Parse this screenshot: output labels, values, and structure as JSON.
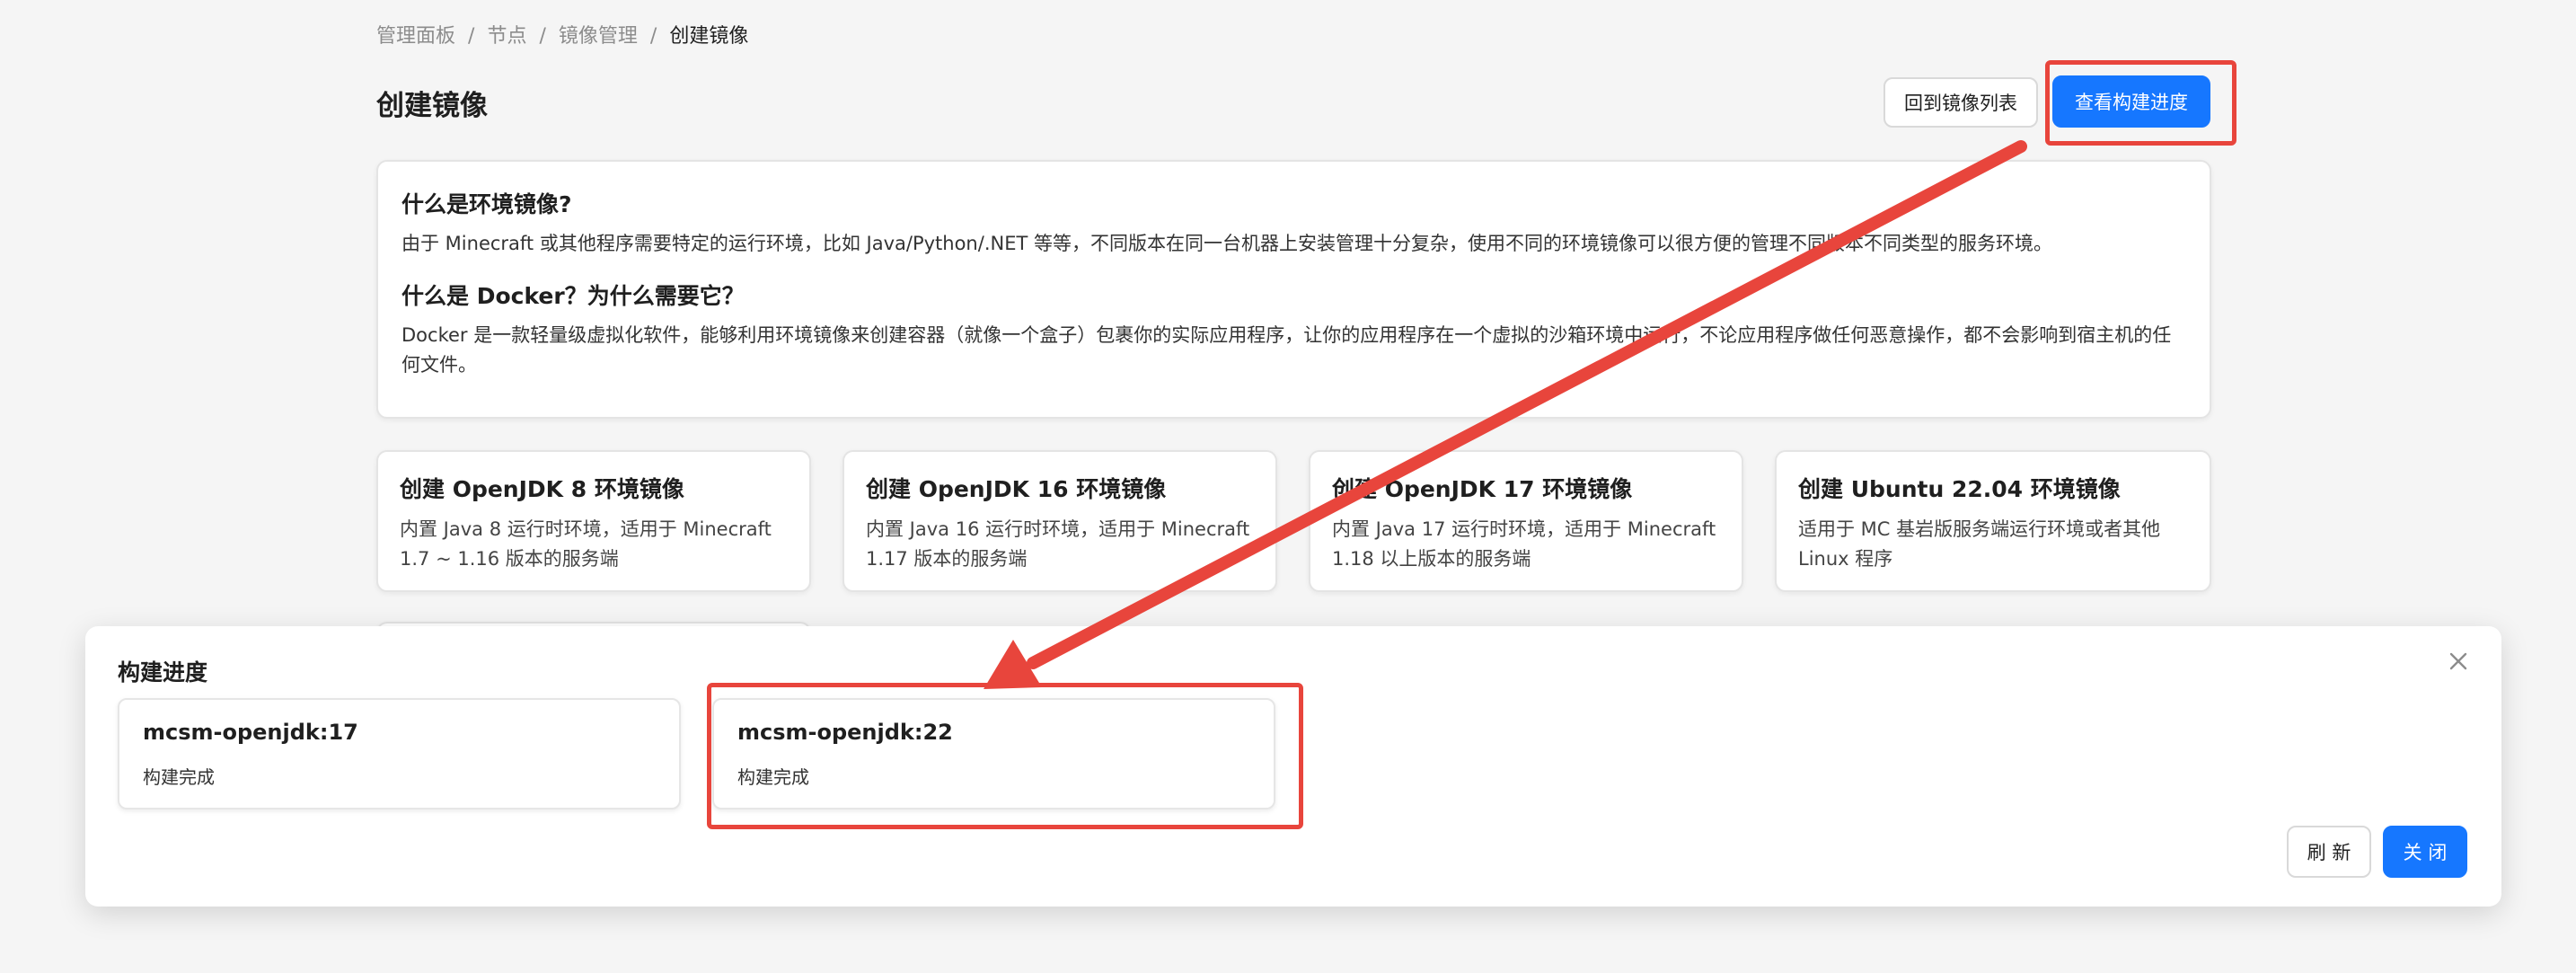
{
  "breadcrumb": {
    "items": [
      "管理面板",
      "节点",
      "镜像管理"
    ],
    "current": "创建镜像",
    "separator": "/"
  },
  "page": {
    "title": "创建镜像",
    "back_button": "回到镜像列表",
    "progress_button": "查看构建进度"
  },
  "info": {
    "q1": "什么是环境镜像?",
    "a1": "由于 Minecraft 或其他程序需要特定的运行环境，比如 Java/Python/.NET 等等，不同版本在同一台机器上安装管理十分复杂，使用不同的环境镜像可以很方便的管理不同版本不同类型的服务环境。",
    "q2": "什么是 Docker？为什么需要它？",
    "a2": "Docker 是一款轻量级虚拟化软件，能够利用环境镜像来创建容器（就像一个盒子）包裹你的实际应用程序，让你的应用程序在一个虚拟的沙箱环境中运行，不论应用程序做任何恶意操作，都不会影响到宿主机的任何文件。"
  },
  "templates": [
    {
      "title": "创建 OpenJDK 8 环境镜像",
      "desc": "内置 Java 8 运行时环境，适用于 Minecraft 1.7 ~ 1.16 版本的服务端"
    },
    {
      "title": "创建 OpenJDK 16 环境镜像",
      "desc": "内置 Java 16 运行时环境，适用于 Minecraft 1.17 版本的服务端"
    },
    {
      "title": "创建 OpenJDK 17 环境镜像",
      "desc": "内置 Java 17 运行时环境，适用于 Minecraft 1.18 以上版本的服务端"
    },
    {
      "title": "创建 Ubuntu 22.04 环境镜像",
      "desc": "适用于 MC 基岩版服务端运行环境或者其他 Linux 程序"
    }
  ],
  "modal": {
    "title": "构建进度",
    "close_icon": "close-icon",
    "jobs": [
      {
        "name": "mcsm-openjdk:17",
        "status": "构建完成"
      },
      {
        "name": "mcsm-openjdk:22",
        "status": "构建完成"
      }
    ],
    "refresh_button": "刷 新",
    "close_button": "关 闭"
  },
  "colors": {
    "primary": "#1677ff",
    "annotation": "#e8453c",
    "background": "#f5f5f5"
  }
}
